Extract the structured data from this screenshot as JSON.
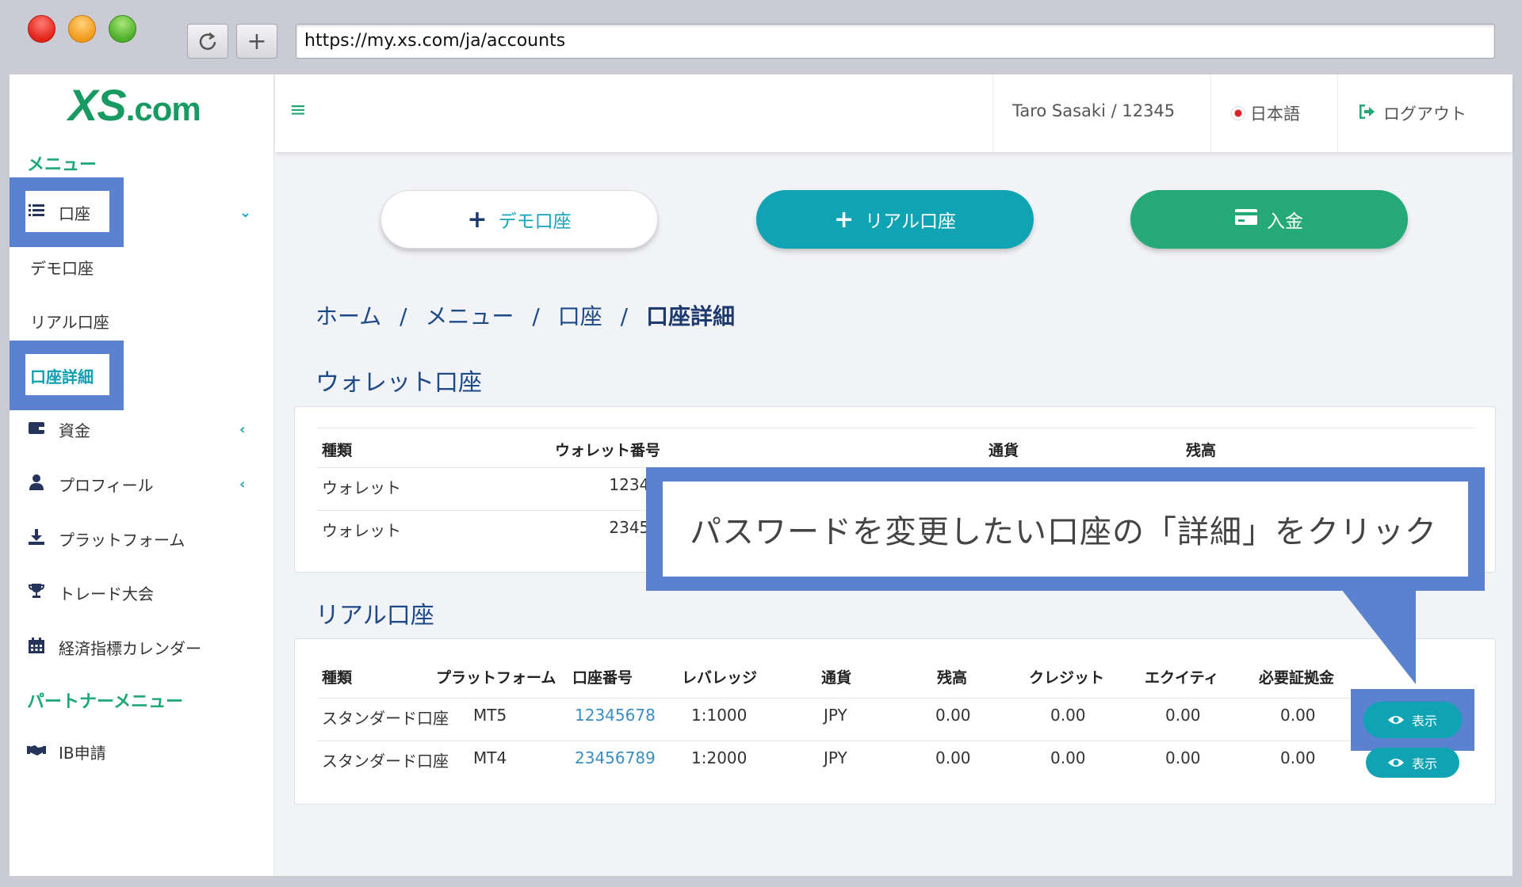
{
  "browser": {
    "url": "https://my.xs.com/ja/accounts",
    "reload_icon": "reload-icon",
    "new_tab_icon": "plus-icon"
  },
  "logo": {
    "xs": "XS",
    "com": ".com"
  },
  "sidebar": {
    "menu_label": "メニュー",
    "items": [
      {
        "label": "口座",
        "icon": "list-icon"
      },
      {
        "label": "デモ口座"
      },
      {
        "label": "リアル口座"
      },
      {
        "label": "口座詳細"
      },
      {
        "label": "資金",
        "icon": "wallet-icon"
      },
      {
        "label": "プロフィール",
        "icon": "user-icon"
      },
      {
        "label": "プラットフォーム",
        "icon": "download-icon"
      },
      {
        "label": "トレード大会",
        "icon": "trophy-icon"
      },
      {
        "label": "経済指標カレンダー",
        "icon": "calendar-icon"
      }
    ],
    "partner_label": "パートナーメニュー",
    "partner_items": [
      {
        "label": "IB申請",
        "icon": "handshake-icon"
      }
    ]
  },
  "topbar": {
    "user": "Taro Sasaki / 12345",
    "language": "日本語",
    "logout": "ログアウト"
  },
  "actions": {
    "demo": "デモ口座",
    "real": "リアル口座",
    "deposit": "入金"
  },
  "breadcrumb": {
    "home": "ホーム",
    "menu": "メニュー",
    "account": "口座",
    "current": "口座詳細",
    "sep": "/"
  },
  "wallet": {
    "title": "ウォレット口座",
    "headers": [
      "種類",
      "ウォレット番号",
      "通貨",
      "残高"
    ],
    "rows": [
      [
        "ウォレット",
        "12345"
      ],
      [
        "ウォレット",
        "23456"
      ]
    ]
  },
  "real": {
    "title": "リアル口座",
    "headers": [
      "種類",
      "プラットフォーム",
      "口座番号",
      "レバレッジ",
      "通貨",
      "残高",
      "クレジット",
      "エクイティ",
      "必要証拠金"
    ],
    "rows": [
      [
        "スタンダード口座",
        "MT5",
        "12345678",
        "1:1000",
        "JPY",
        "0.00",
        "0.00",
        "0.00",
        "0.00"
      ],
      [
        "スタンダード口座",
        "MT4",
        "23456789",
        "1:2000",
        "JPY",
        "0.00",
        "0.00",
        "0.00",
        "0.00"
      ]
    ],
    "show_label": "表示"
  },
  "callout": "パスワードを変更したい口座の「詳細」をクリック",
  "colors": {
    "accent_green": "#1fa876",
    "accent_teal": "#0fa3b4",
    "highlight_blue": "#5b82cf",
    "navy_text": "#1d4a86"
  }
}
